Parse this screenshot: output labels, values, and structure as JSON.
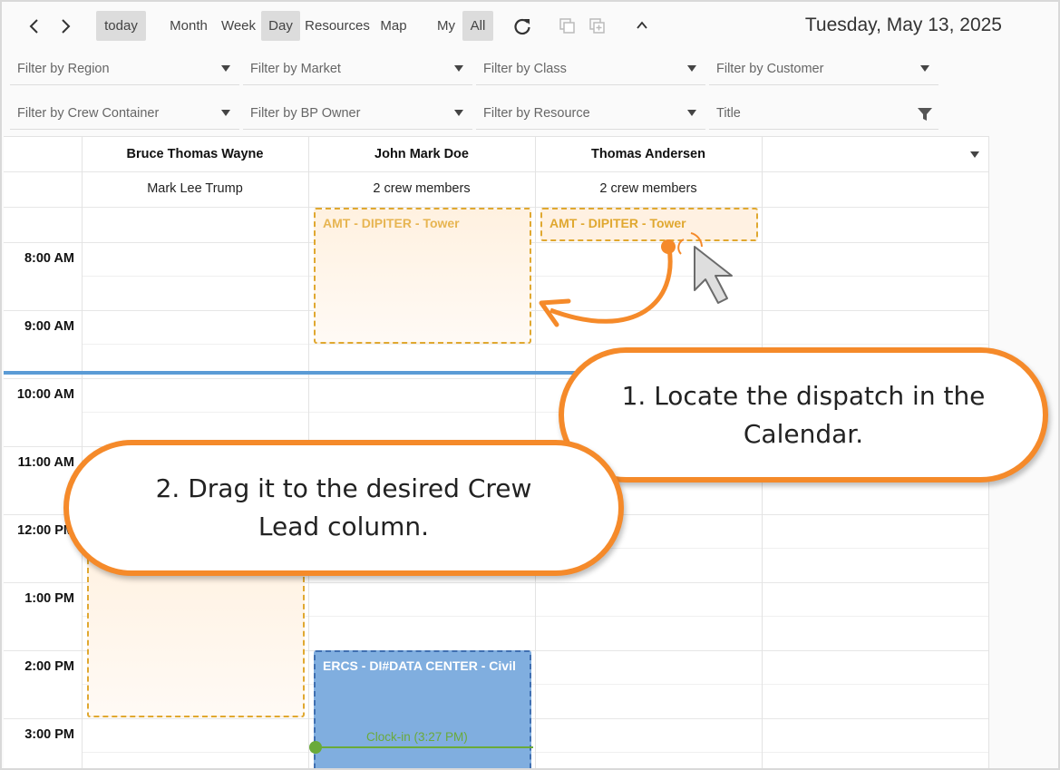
{
  "toolbar": {
    "prev_icon": "chevron-left-icon",
    "next_icon": "chevron-right-icon",
    "today_label": "today",
    "month_label": "Month",
    "week_label": "Week",
    "day_label": "Day",
    "resources_label": "Resources",
    "map_label": "Map",
    "my_label": "My",
    "all_label": "All",
    "refresh_icon": "refresh-icon",
    "copy_icon": "copy-icon",
    "add_copy_icon": "add-copy-icon",
    "collapse_icon": "chevron-up-icon",
    "date_title": "Tuesday, May 13, 2025"
  },
  "filters": {
    "region": "Filter by Region",
    "market": "Filter by Market",
    "class": "Filter by Class",
    "customer": "Filter by Customer",
    "crew_container": "Filter by Crew Container",
    "bp_owner": "Filter by BP Owner",
    "resource": "Filter by Resource",
    "title": "Title"
  },
  "columns": [
    {
      "name": "Bruce Thomas Wayne",
      "sub": "Mark Lee Trump"
    },
    {
      "name": "John Mark Doe",
      "sub": "2 crew members"
    },
    {
      "name": "Thomas Andersen",
      "sub": "2 crew members"
    }
  ],
  "times": [
    "8:00 AM",
    "9:00 AM",
    "10:00 AM",
    "11:00 AM",
    "12:00 PM",
    "1:00 PM",
    "2:00 PM",
    "3:00 PM"
  ],
  "events": {
    "ghost_title": "AMT - DIPITER - Tower",
    "dragged_title": "AMT - DIPITER - Tower",
    "blue_title": "ERCS - DI#DATA CENTER - Civil",
    "clock_in": "Clock-in (3:27 PM)"
  },
  "callouts": {
    "step1": "1. Locate the dispatch in the Calendar.",
    "step2": "2. Drag it to the desired Crew Lead column."
  },
  "colors": {
    "accent_orange": "#f58a2a",
    "event_border": "#e0a830",
    "event_blue": "#80aedf",
    "now_line": "#5b9bd5",
    "clock_green": "#6aaa3a"
  }
}
